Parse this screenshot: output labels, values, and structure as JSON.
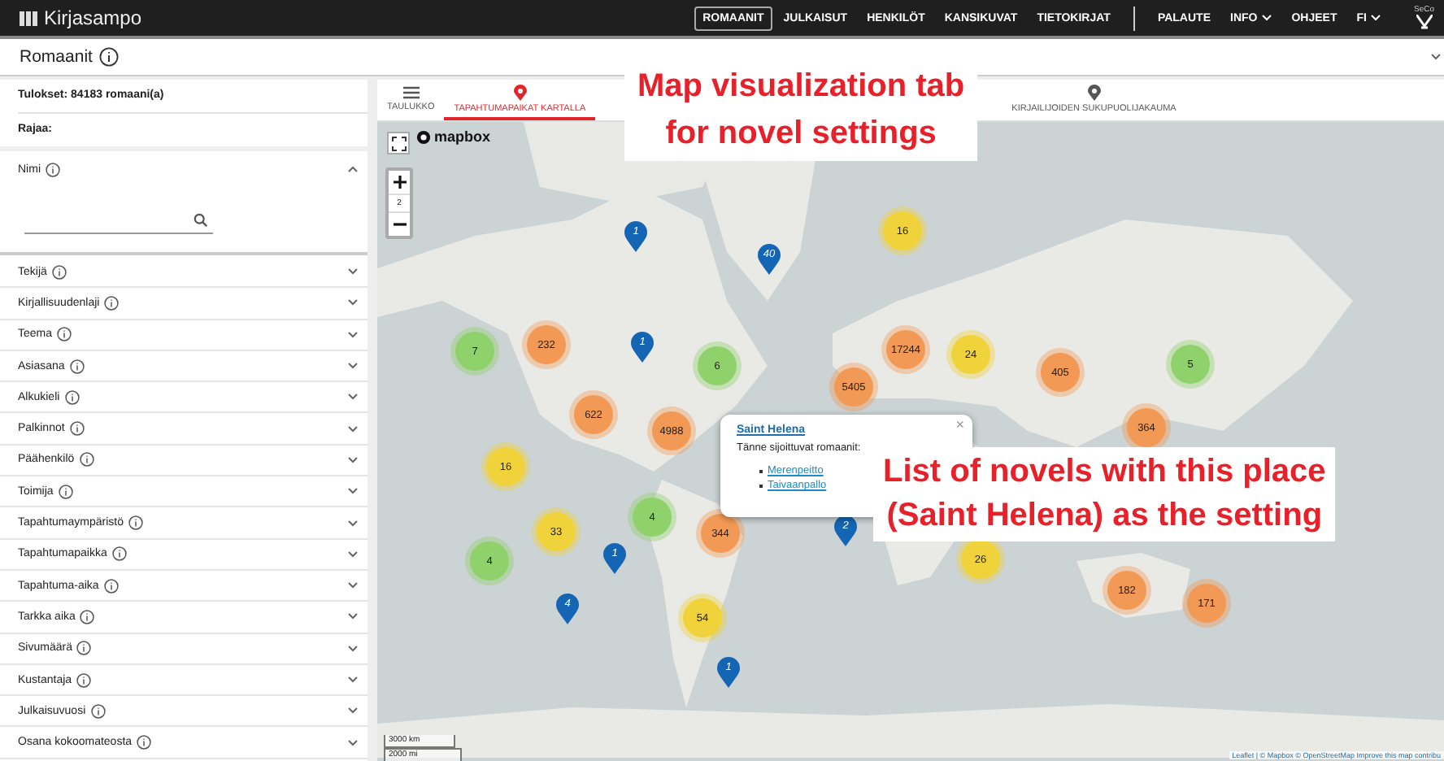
{
  "app": {
    "title": "Kirjasampo",
    "logo_text": "SeCo"
  },
  "nav": [
    {
      "label": "ROMAANIT",
      "selected": true,
      "dropdown": false
    },
    {
      "label": "JULKAISUT",
      "selected": false,
      "dropdown": false
    },
    {
      "label": "HENKILÖT",
      "selected": false,
      "dropdown": false
    },
    {
      "label": "KANSIKUVAT",
      "selected": false,
      "dropdown": false
    },
    {
      "label": "TIETOKIRJAT",
      "selected": false,
      "dropdown": false
    },
    {
      "label": "PALAUTE",
      "selected": false,
      "dropdown": false,
      "divider_before": true
    },
    {
      "label": "INFO",
      "selected": false,
      "dropdown": true
    },
    {
      "label": "OHJEET",
      "selected": false,
      "dropdown": false
    },
    {
      "label": "FI",
      "selected": false,
      "dropdown": true
    }
  ],
  "page_title": "Romaanit",
  "results": {
    "count": "Tulokset: 84183 romaani(a)",
    "filter_label": "Rajaa:"
  },
  "name_filter": {
    "label": "Nimi",
    "expanded": true
  },
  "facets": [
    {
      "label": "Tekijä",
      "expanded": false
    },
    {
      "label": "Kirjallisuudenlaji",
      "expanded": false
    },
    {
      "label": "Teema",
      "expanded": false
    },
    {
      "label": "Asiasana",
      "expanded": false
    },
    {
      "label": "Alkukieli",
      "expanded": false
    },
    {
      "label": "Palkinnot",
      "expanded": false
    },
    {
      "label": "Päähenkilö",
      "expanded": false
    },
    {
      "label": "Toimija",
      "expanded": false
    },
    {
      "label": "Tapahtumaympäristö",
      "expanded": false
    },
    {
      "label": "Tapahtumapaikka",
      "expanded": false
    },
    {
      "label": "Tapahtuma-aika",
      "expanded": false
    },
    {
      "label": "Tarkka aika",
      "expanded": false
    },
    {
      "label": "Sivumäärä",
      "expanded": false
    },
    {
      "label": "Kustantaja",
      "expanded": false
    },
    {
      "label": "Julkaisuvuosi",
      "expanded": false
    },
    {
      "label": "Osana kokoomateosta",
      "expanded": false
    }
  ],
  "tabs": [
    {
      "label": "TAULUKKO",
      "kind": "table",
      "selected": false
    },
    {
      "label": "TAPAHTUMAPAIKAT KARTALLA",
      "kind": "pin",
      "selected": true
    },
    {
      "label": "KIRJAILIJOIDEN SUKUPUOLIJAKAUMA",
      "kind": "pin",
      "selected": false
    }
  ],
  "map": {
    "brand": "mapbox",
    "zoom_level": "2",
    "scale": [
      "3000 km",
      "2000 mi"
    ],
    "attribution": "Leaflet | © Mapbox © OpenStreetMap Improve this map contribu",
    "clusters": [
      {
        "count": "7",
        "color": "#8fd16a"
      },
      {
        "count": "232",
        "color": "#f29a55"
      },
      {
        "count": "6",
        "color": "#8fd16a"
      },
      {
        "count": "622",
        "color": "#f29a55"
      },
      {
        "count": "4988",
        "color": "#f29a55"
      },
      {
        "count": "16",
        "color": "#f0d33a"
      },
      {
        "count": "33",
        "color": "#f0d33a"
      },
      {
        "count": "4",
        "color": "#8fd16a"
      },
      {
        "count": "4",
        "color": "#8fd16a"
      },
      {
        "count": "344",
        "color": "#f29a55"
      },
      {
        "count": "54",
        "color": "#f0d33a"
      },
      {
        "count": "16",
        "color": "#f0d33a"
      },
      {
        "count": "17244",
        "color": "#f29a55"
      },
      {
        "count": "24",
        "color": "#f0d33a"
      },
      {
        "count": "5405",
        "color": "#f29a55"
      },
      {
        "count": "405",
        "color": "#f29a55"
      },
      {
        "count": "5",
        "color": "#8fd16a"
      },
      {
        "count": "364",
        "color": "#f29a55"
      },
      {
        "count": "26",
        "color": "#f0d33a"
      },
      {
        "count": "182",
        "color": "#f29a55"
      },
      {
        "count": "171",
        "color": "#f29a55"
      }
    ],
    "pins": [
      "1",
      "40",
      "1",
      "2",
      "1",
      "4",
      "1"
    ],
    "popup": {
      "title": "Saint Helena",
      "subtitle": "Tänne sijoittuvat romaanit:",
      "close": "×",
      "novels": [
        "Merenpeitto",
        "Taivaanpallo"
      ]
    }
  },
  "callouts": [
    "Map visualization tab\nfor novel settings",
    "List of novels with this place\n(Saint Helena) as the setting"
  ]
}
